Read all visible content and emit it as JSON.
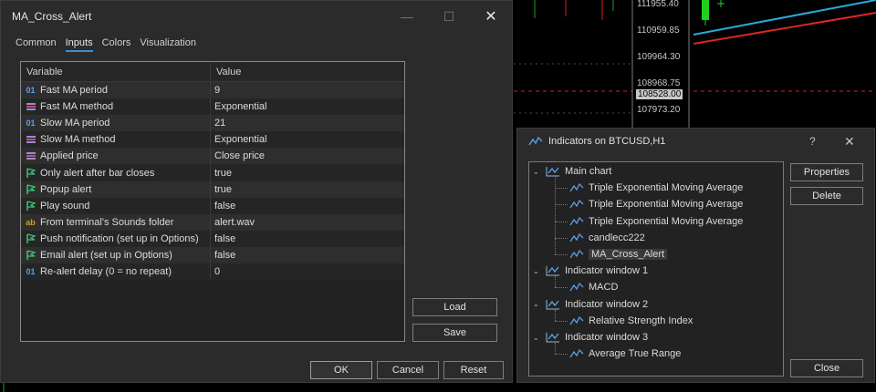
{
  "chart": {
    "price_labels": [
      "111955.40",
      "110959.85",
      "109964.30",
      "108968.75",
      "108528.00",
      "107973.20"
    ],
    "colors": {
      "ma_fast": "#2aa9e0",
      "ma_slow": "#e02525",
      "bull_candle": "#20d020",
      "grid": "#2f4f2f"
    }
  },
  "ma_dialog": {
    "title": "MA_Cross_Alert",
    "tabs": [
      "Common",
      "Inputs",
      "Colors",
      "Visualization"
    ],
    "active_tab": "Inputs",
    "columns": {
      "variable": "Variable",
      "value": "Value"
    },
    "params": [
      {
        "type": "int",
        "icon": "01",
        "name": "Fast MA period",
        "value": "9"
      },
      {
        "type": "enum",
        "icon": "enum-icon",
        "name": "Fast MA method",
        "value": "Exponential"
      },
      {
        "type": "int",
        "icon": "01",
        "name": "Slow MA period",
        "value": "21"
      },
      {
        "type": "enum",
        "icon": "enum-icon",
        "name": "Slow MA method",
        "value": "Exponential"
      },
      {
        "type": "enum",
        "icon": "enum-icon",
        "name": "Applied price",
        "value": "Close price"
      },
      {
        "type": "bool",
        "icon": "flag-icon",
        "name": "Only alert after bar closes",
        "value": "true"
      },
      {
        "type": "bool",
        "icon": "flag-icon",
        "name": "Popup alert",
        "value": "true"
      },
      {
        "type": "bool",
        "icon": "flag-icon",
        "name": "Play sound",
        "value": "false"
      },
      {
        "type": "str",
        "icon": "ab",
        "name": "From terminal's Sounds folder",
        "value": "alert.wav"
      },
      {
        "type": "bool",
        "icon": "flag-icon",
        "name": "Push notification (set up in Options)",
        "value": "false"
      },
      {
        "type": "bool",
        "icon": "flag-icon",
        "name": "Email alert (set up in Options)",
        "value": "false"
      },
      {
        "type": "int",
        "icon": "01",
        "name": "Re-alert delay (0 = no repeat)",
        "value": "0"
      }
    ],
    "buttons": {
      "load": "Load",
      "save": "Save",
      "ok": "OK",
      "cancel": "Cancel",
      "reset": "Reset"
    }
  },
  "indicators_panel": {
    "title": "Indicators on BTCUSD,H1",
    "help": "?",
    "tree": [
      {
        "label": "Main chart",
        "level": 0
      },
      {
        "label": "Triple Exponential Moving Average",
        "level": 1
      },
      {
        "label": "Triple Exponential Moving Average",
        "level": 1
      },
      {
        "label": "Triple Exponential Moving Average",
        "level": 1
      },
      {
        "label": "candlecc222",
        "level": 1
      },
      {
        "label": "MA_Cross_Alert",
        "level": 1,
        "selected": true
      },
      {
        "label": "Indicator window 1",
        "level": 0
      },
      {
        "label": "MACD",
        "level": 1
      },
      {
        "label": "Indicator window 2",
        "level": 0
      },
      {
        "label": "Relative Strength Index",
        "level": 1
      },
      {
        "label": "Indicator window 3",
        "level": 0
      },
      {
        "label": "Average True Range",
        "level": 1
      }
    ],
    "buttons": {
      "properties": "Properties",
      "delete": "Delete",
      "close": "Close"
    }
  }
}
